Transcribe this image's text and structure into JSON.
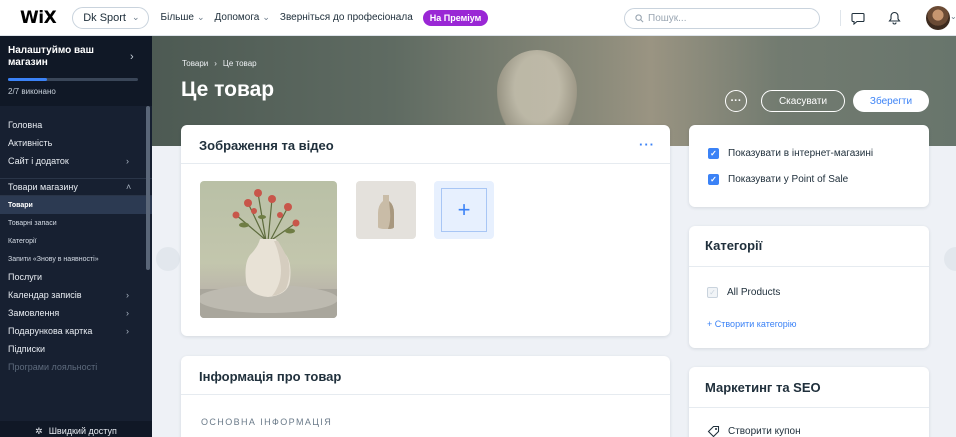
{
  "topbar": {
    "logo": "WiX",
    "site_name": "Dk Sport",
    "nav": [
      {
        "label": "Більше"
      },
      {
        "label": "Допомога"
      },
      {
        "label": "Зверніться до професіонала"
      }
    ],
    "premium_badge": "На Преміум",
    "search_placeholder": "Пошук..."
  },
  "sidebar": {
    "setup_title": "Налаштуймо ваш магазин",
    "setup_progress": "2/7 виконано",
    "setup_progress_fraction": 0.3,
    "items": [
      {
        "label": "Головна"
      },
      {
        "label": "Активність"
      },
      {
        "label": "Сайт і додаток"
      },
      {
        "label": "Товари магазину"
      },
      {
        "label": "Товари"
      },
      {
        "label": "Товарні запаси"
      },
      {
        "label": "Категорії"
      },
      {
        "label": "Запити «Знову в наявності»"
      },
      {
        "label": "Послуги"
      },
      {
        "label": "Календар записів"
      },
      {
        "label": "Замовлення"
      },
      {
        "label": "Подарункова картка"
      },
      {
        "label": "Підписки"
      },
      {
        "label": "Програми лояльності"
      }
    ],
    "quick_access": "Швидкий доступ"
  },
  "header": {
    "breadcrumb": [
      "Товари",
      "Це товар"
    ],
    "title": "Це товар",
    "cancel_label": "Скасувати",
    "save_label": "Зберегти"
  },
  "media": {
    "title": "Зображення та відео",
    "more": "···"
  },
  "info": {
    "title": "Інформація про товар",
    "section": "ОСНОВНА ІНФОРМАЦІЯ"
  },
  "visibility": {
    "options": [
      {
        "label": "Показувати в інтернет-магазині",
        "checked": true
      },
      {
        "label": "Показувати у Point of Sale",
        "checked": true
      }
    ]
  },
  "categories": {
    "title": "Категорії",
    "items": [
      {
        "label": "All Products"
      }
    ],
    "create_label": "+ Створити категорію"
  },
  "marketing": {
    "title": "Маркетинг та SEO",
    "coupon_label": "Створити купон"
  },
  "colors": {
    "accent": "#3b82f6",
    "premium": "#9a27d5",
    "sidebar_bg": "#172031"
  }
}
